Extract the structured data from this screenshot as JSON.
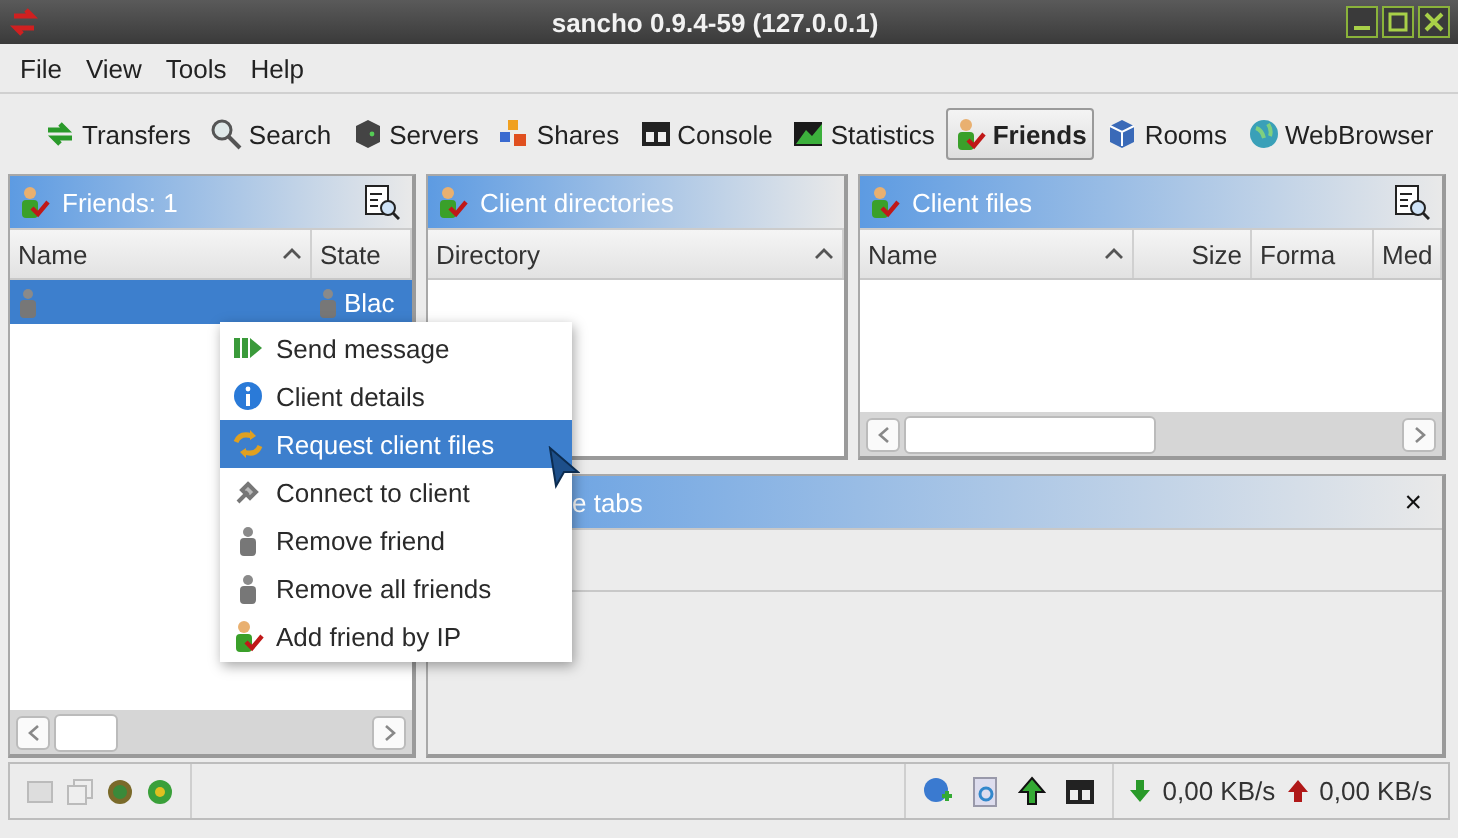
{
  "window": {
    "title": "sancho 0.9.4-59 (127.0.0.1)"
  },
  "menu": [
    "File",
    "View",
    "Tools",
    "Help"
  ],
  "toolbar": [
    {
      "label": "Transfers",
      "kind": "transfers",
      "selected": false
    },
    {
      "label": "Search",
      "kind": "search",
      "selected": false
    },
    {
      "label": "Servers",
      "kind": "servers",
      "selected": false
    },
    {
      "label": "Shares",
      "kind": "shares",
      "selected": false
    },
    {
      "label": "Console",
      "kind": "console",
      "selected": false
    },
    {
      "label": "Statistics",
      "kind": "statistics",
      "selected": false
    },
    {
      "label": "Friends",
      "kind": "friends",
      "selected": true
    },
    {
      "label": "Rooms",
      "kind": "rooms",
      "selected": false
    },
    {
      "label": "WebBrowser",
      "kind": "web",
      "selected": false
    }
  ],
  "friends_panel": {
    "title": "Friends: 1",
    "columns": [
      "Name",
      "State"
    ],
    "rows": [
      {
        "state": "Blac",
        "selected": true
      }
    ]
  },
  "directories_panel": {
    "title": "Client directories",
    "columns": [
      "Directory"
    ]
  },
  "files_panel": {
    "title": "Client files",
    "columns": [
      "Name",
      "Size",
      "Forma",
      "Med"
    ]
  },
  "tabs_panel": {
    "title": "e tabs",
    "close": "×"
  },
  "context_menu": [
    {
      "label": "Send message",
      "kind": "message",
      "selected": false
    },
    {
      "label": "Client details",
      "kind": "info",
      "selected": false
    },
    {
      "label": "Request client files",
      "kind": "request",
      "selected": true
    },
    {
      "label": "Connect to client",
      "kind": "connect",
      "selected": false
    },
    {
      "label": "Remove friend",
      "kind": "person",
      "selected": false
    },
    {
      "label": "Remove all friends",
      "kind": "person",
      "selected": false
    },
    {
      "label": "Add friend by IP",
      "kind": "friend",
      "selected": false
    }
  ],
  "status_bar": {
    "download": "0,00 KB/s",
    "upload": "0,00 KB/s"
  }
}
